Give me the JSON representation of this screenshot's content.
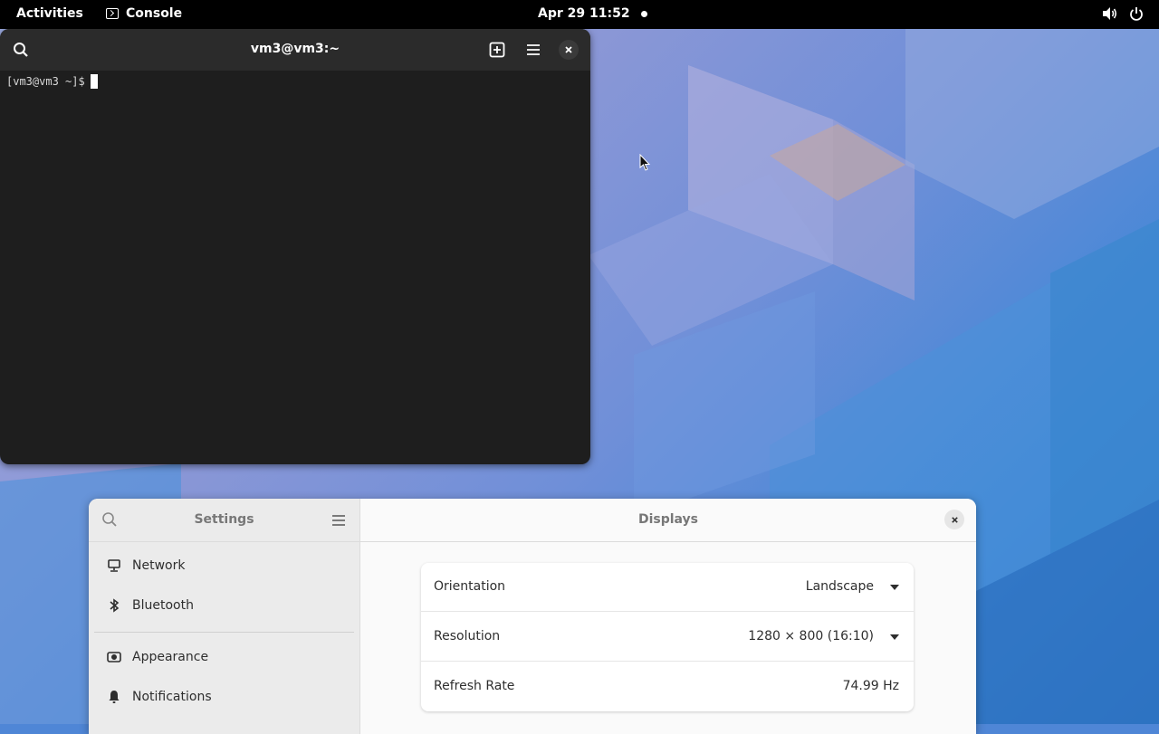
{
  "topbar": {
    "activities": "Activities",
    "app_name": "Console",
    "clock": "Apr 29  11:52"
  },
  "terminal": {
    "title": "vm3@vm3:~",
    "prompt": "[vm3@vm3 ~]$"
  },
  "settings": {
    "sidebar_title": "Settings",
    "items": [
      {
        "label": "Network",
        "icon": "network-icon"
      },
      {
        "label": "Bluetooth",
        "icon": "bluetooth-icon"
      },
      {
        "label": "Appearance",
        "icon": "appearance-icon"
      },
      {
        "label": "Notifications",
        "icon": "bell-icon"
      }
    ],
    "panel_title": "Displays",
    "rows": [
      {
        "label": "Orientation",
        "value": "Landscape"
      },
      {
        "label": "Resolution",
        "value": "1280 × 800 (16:10)"
      },
      {
        "label": "Refresh Rate",
        "value": "74.99 Hz"
      }
    ]
  },
  "colors": {
    "topbar": "#000000",
    "terminal_bg": "#1e1e1e",
    "terminal_header": "#2b2b2b",
    "settings_sidebar": "#ebebeb",
    "settings_main": "#fafafa"
  }
}
